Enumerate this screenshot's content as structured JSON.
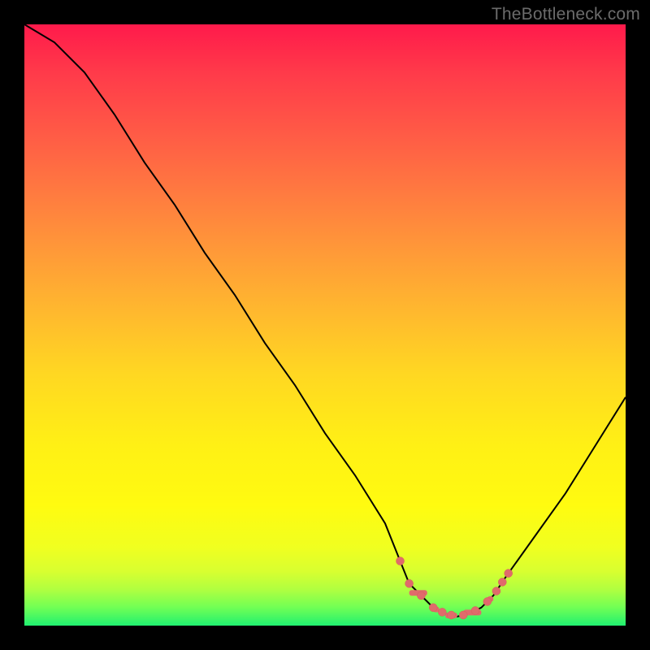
{
  "watermark": "TheBottleneck.com",
  "colors": {
    "marker": "#e06b6b",
    "line": "#000000",
    "frame": "#000000"
  },
  "chart_data": {
    "type": "line",
    "title": "",
    "xlabel": "",
    "ylabel": "",
    "xlim": [
      0,
      100
    ],
    "ylim": [
      0,
      100
    ],
    "x": [
      0,
      5,
      10,
      15,
      20,
      25,
      30,
      35,
      40,
      45,
      50,
      55,
      60,
      62,
      64,
      66,
      68,
      70,
      72,
      74,
      76,
      78,
      80,
      85,
      90,
      95,
      100
    ],
    "values": [
      100,
      97,
      92,
      85,
      77,
      70,
      62,
      55,
      47,
      40,
      32,
      25,
      17,
      12,
      7,
      5,
      3,
      2,
      1.5,
      2,
      3,
      5,
      8,
      15,
      22,
      30,
      38
    ],
    "marker_x": [
      62.5,
      64,
      66,
      68,
      69.5,
      71,
      73,
      75,
      77,
      78.5,
      79.5,
      80.5
    ],
    "dash_segments": [
      [
        64,
        67
      ],
      [
        68,
        69
      ],
      [
        70,
        72
      ],
      [
        73,
        76
      ],
      [
        77,
        78
      ]
    ]
  }
}
